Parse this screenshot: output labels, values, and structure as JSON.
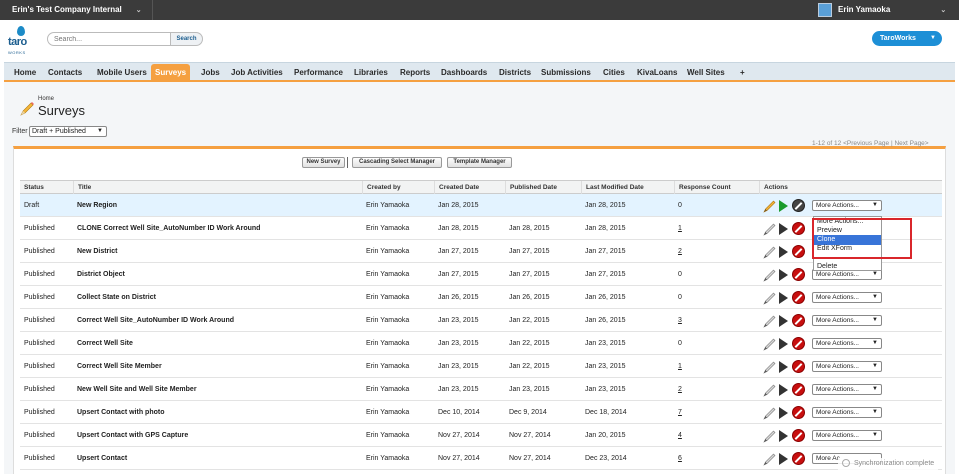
{
  "topbar": {
    "org_name": "Erin's Test Company Internal",
    "user_name": "Erin Yamaoka"
  },
  "header": {
    "logo_text": "taro",
    "logo_sub": "WORKS",
    "search_placeholder": "Search...",
    "search_button": "Search",
    "app_switcher": "TaroWorks"
  },
  "tabs": [
    "Home",
    "Contacts",
    "Mobile Users",
    "Surveys",
    "Jobs",
    "Job Activities",
    "Performance",
    "Libraries",
    "Reports",
    "Dashboards",
    "Districts",
    "Submissions",
    "Cities",
    "KivaLoans",
    "Well Sites",
    "+"
  ],
  "active_tab": "Surveys",
  "page": {
    "breadcrumb": "Home",
    "title": "Surveys",
    "filter_label": "Filter",
    "filter_value": "Draft + Published"
  },
  "pagination": "1-12 of 12 <Previous Page | Next Page>",
  "buttons": {
    "new_survey": "New Survey",
    "cascading": "Cascading Select Manager",
    "template": "Template Manager"
  },
  "columns": [
    "Status",
    "Title",
    "Created by",
    "Created Date",
    "Published Date",
    "Last Modified Date",
    "Response Count",
    "Actions"
  ],
  "rows": [
    {
      "status": "Draft",
      "title": "New Region",
      "created_by": "Erin Yamaoka",
      "created": "Jan 28, 2015",
      "published": "",
      "modified": "Jan 28, 2015",
      "count": "0",
      "count_link": false
    },
    {
      "status": "Published",
      "title": "CLONE Correct Well Site_AutoNumber ID Work Around",
      "created_by": "Erin Yamaoka",
      "created": "Jan 28, 2015",
      "published": "Jan 28, 2015",
      "modified": "Jan 28, 2015",
      "count": "1",
      "count_link": true
    },
    {
      "status": "Published",
      "title": "New District",
      "created_by": "Erin Yamaoka",
      "created": "Jan 27, 2015",
      "published": "Jan 27, 2015",
      "modified": "Jan 27, 2015",
      "count": "2",
      "count_link": true
    },
    {
      "status": "Published",
      "title": "District Object",
      "created_by": "Erin Yamaoka",
      "created": "Jan 27, 2015",
      "published": "Jan 27, 2015",
      "modified": "Jan 27, 2015",
      "count": "0",
      "count_link": false
    },
    {
      "status": "Published",
      "title": "Collect State on District",
      "created_by": "Erin Yamaoka",
      "created": "Jan 26, 2015",
      "published": "Jan 26, 2015",
      "modified": "Jan 26, 2015",
      "count": "0",
      "count_link": false
    },
    {
      "status": "Published",
      "title": "Correct Well Site_AutoNumber ID Work Around",
      "created_by": "Erin Yamaoka",
      "created": "Jan 23, 2015",
      "published": "Jan 22, 2015",
      "modified": "Jan 26, 2015",
      "count": "3",
      "count_link": true
    },
    {
      "status": "Published",
      "title": "Correct Well Site",
      "created_by": "Erin Yamaoka",
      "created": "Jan 23, 2015",
      "published": "Jan 22, 2015",
      "modified": "Jan 23, 2015",
      "count": "0",
      "count_link": false
    },
    {
      "status": "Published",
      "title": "Correct Well Site Member",
      "created_by": "Erin Yamaoka",
      "created": "Jan 23, 2015",
      "published": "Jan 22, 2015",
      "modified": "Jan 23, 2015",
      "count": "1",
      "count_link": true
    },
    {
      "status": "Published",
      "title": "New Well Site and Well Site Member",
      "created_by": "Erin Yamaoka",
      "created": "Jan 23, 2015",
      "published": "Jan 23, 2015",
      "modified": "Jan 23, 2015",
      "count": "2",
      "count_link": true
    },
    {
      "status": "Published",
      "title": "Upsert Contact with photo",
      "created_by": "Erin Yamaoka",
      "created": "Dec 10, 2014",
      "published": "Dec 9, 2014",
      "modified": "Dec 18, 2014",
      "count": "7",
      "count_link": true
    },
    {
      "status": "Published",
      "title": "Upsert Contact with GPS Capture",
      "created_by": "Erin Yamaoka",
      "created": "Nov 27, 2014",
      "published": "Nov 27, 2014",
      "modified": "Jan 20, 2015",
      "count": "4",
      "count_link": true
    },
    {
      "status": "Published",
      "title": "Upsert Contact",
      "created_by": "Erin Yamaoka",
      "created": "Nov 27, 2014",
      "published": "Nov 27, 2014",
      "modified": "Dec 23, 2014",
      "count": "6",
      "count_link": true
    }
  ],
  "more_actions_label": "More Actions...",
  "more_actions_short": "More Ac",
  "dropdown_items": [
    "More Actions...",
    "Preview",
    "Clone",
    "Edit XForm",
    "",
    "Delete"
  ],
  "dropdown_selected": "Clone",
  "toast": "Synchronization complete"
}
